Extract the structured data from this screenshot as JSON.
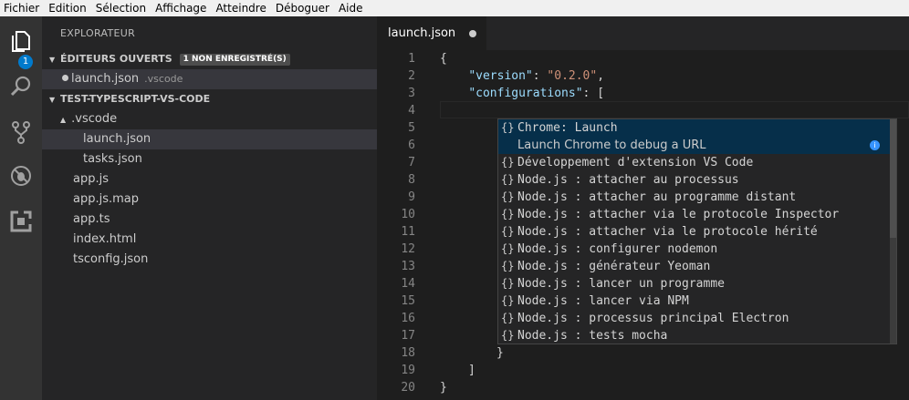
{
  "menu": [
    "Fichier",
    "Edition",
    "Sélection",
    "Affichage",
    "Atteindre",
    "Déboguer",
    "Aide"
  ],
  "activity": {
    "explorer_badge": "1"
  },
  "sidebar": {
    "title": "EXPLORATEUR",
    "open_editors": {
      "label": "ÉDITEURS OUVERTS",
      "badge": "1 NON ENREGISTRÉ(S)",
      "file": "launch.json",
      "folder": ".vscode"
    },
    "project": {
      "label": "TEST-TYPESCRIPT-VS-CODE"
    },
    "tree": [
      ".vscode",
      "launch.json",
      "tasks.json",
      "app.js",
      "app.js.map",
      "app.ts",
      "index.html",
      "tsconfig.json"
    ]
  },
  "tab": {
    "label": "launch.json"
  },
  "editor": {
    "line_numbers": [
      "1",
      "2",
      "3",
      "4",
      "5",
      "6",
      "7",
      "8",
      "9",
      "10",
      "11",
      "12",
      "13",
      "14",
      "15",
      "16",
      "17",
      "18",
      "19",
      "20"
    ],
    "lines": {
      "l1": "{",
      "l2_key": "\"version\"",
      "l2_sep": ": ",
      "l2_val": "\"0.2.0\"",
      "l2_end": ",",
      "l3_key": "\"configurations\"",
      "l3_rest": ": [",
      "l18": "}",
      "l19": "]",
      "l20": "}"
    }
  },
  "suggest": {
    "icon": "{}",
    "items": [
      "Chrome: Launch",
      "Développement d'extension VS Code",
      "Node.js : attacher au processus",
      "Node.js : attacher au programme distant",
      "Node.js : attacher via le protocole Inspector",
      "Node.js : attacher via le protocole hérité",
      "Node.js : configurer nodemon",
      "Node.js : générateur Yeoman",
      "Node.js : lancer un programme",
      "Node.js : lancer via NPM",
      "Node.js : processus principal Electron",
      "Node.js : tests mocha"
    ],
    "detail": "Launch Chrome to debug a URL"
  }
}
